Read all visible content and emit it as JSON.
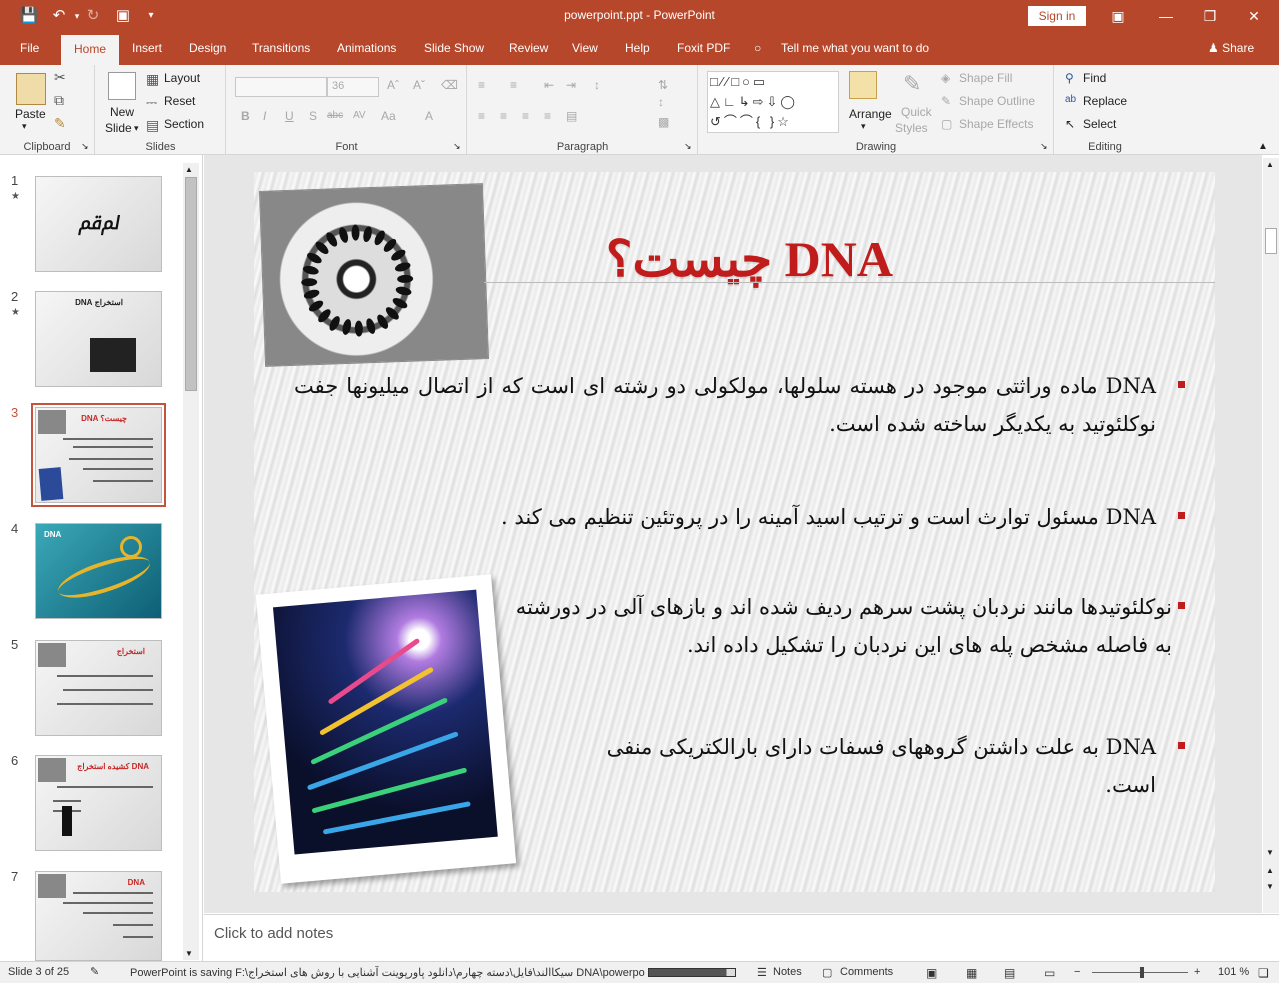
{
  "app": {
    "doc_title": "powerpoint.ppt  -  PowerPoint",
    "sign_in": "Sign in",
    "tell_me": "Tell me what you want to do",
    "share": "Share"
  },
  "tabs": [
    "File",
    "Home",
    "Insert",
    "Design",
    "Transitions",
    "Animations",
    "Slide Show",
    "Review",
    "View",
    "Help",
    "Foxit PDF"
  ],
  "ribbon": {
    "clipboard": {
      "label": "Clipboard",
      "paste": "Paste"
    },
    "slides": {
      "label": "Slides",
      "new_slide": "New",
      "new_slide2": "Slide",
      "layout": "Layout",
      "reset": "Reset",
      "section": "Section"
    },
    "font": {
      "label": "Font",
      "size": "36"
    },
    "paragraph": {
      "label": "Paragraph"
    },
    "drawing": {
      "label": "Drawing",
      "arrange": "Arrange",
      "quick": "Quick",
      "styles": "Styles",
      "shape_fill": "Shape Fill",
      "shape_outline": "Shape Outline",
      "shape_effects": "Shape Effects"
    },
    "editing": {
      "label": "Editing",
      "find": "Find",
      "replace": "Replace",
      "select": "Select"
    }
  },
  "slides_panel": {
    "numbers": [
      "1",
      "2",
      "3",
      "4",
      "5",
      "6",
      "7"
    ],
    "selected": 3,
    "thumb_titles": [
      "",
      "استخراج DNA",
      "DNA چیست؟",
      "DNA",
      "استخراج",
      "کشیده استخراج DNA",
      "DNA"
    ]
  },
  "slide": {
    "title": "DNA چیست؟",
    "bullets": [
      "DNA ماده وراثتی موجود در هسته سلولها، مولکولی دو رشته ای است که از اتصال میلیونها جفت نوکلئوتید به یکدیگر ساخته شده است.",
      "DNA  مسئول توارث است و ترتیب اسید آمینه را در پروتئین تنظیم می کند .",
      "نوکلئوتیدها مانند نردبان پشت سرهم ردیف شده اند و بازهای آلی در دورشته به فاصله مشخص  پله های این نردبان را تشکیل داده اند.",
      "DNA به علت داشتن گروههای فسفات دارای بارالکتریکی منفی است."
    ],
    "accent_color": "#c01c1c"
  },
  "notes": {
    "placeholder": "Click to add notes"
  },
  "status": {
    "slide_info": "Slide 3 of 25",
    "saving": "PowerPoint is saving F:\\سیکاالند\\فایل\\دسته چهارم\\دانلود پاورپوینت آشنایی با روش های استخراج DNA\\powerpoint.ppt.",
    "notes": "Notes",
    "comments": "Comments",
    "zoom": "101 %",
    "save_progress": 0.9
  },
  "colors": {
    "brand": "#b7472a",
    "ribbon_bg": "#f3f3f3"
  }
}
